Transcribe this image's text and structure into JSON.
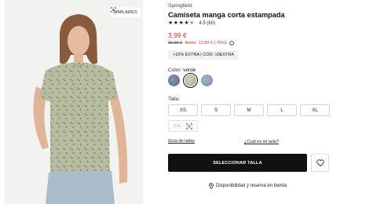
{
  "product": {
    "brand": "Springfield",
    "title": "Camiseta manga corta estampada",
    "rating": {
      "stars": 4.5,
      "text": "4.5 (60)"
    },
    "price": "3,99 €",
    "old_price": "15,99 €",
    "before_text": "Antes: 12,00 € (-75%)",
    "promo": "+10% EXTRA | CÓD: 10EXTRA"
  },
  "image_panel": {
    "similar_label": "SIMILARES"
  },
  "colors": {
    "label": "Color:",
    "selected": "verde",
    "swatches": [
      {
        "name": "azul oscuro",
        "hex": "#6e7f9a"
      },
      {
        "name": "verde",
        "hex": "#b9bfa6",
        "selected": true
      },
      {
        "name": "azul claro",
        "hex": "#8d9fba"
      }
    ]
  },
  "sizes": {
    "label": "Talla:",
    "options": [
      "XS",
      "S",
      "M",
      "L",
      "XL"
    ],
    "unavailable": "XXL"
  },
  "links": {
    "size_guide": "Guía de tallas",
    "which_size": "¿Cuál es mi talla?"
  },
  "actions": {
    "select_size": "SELECCIONAR TALLA",
    "availability": "Disponibilidad y reserva en tienda"
  },
  "style": {
    "accent_price": "#c0392b",
    "cta_bg": "#111111"
  }
}
